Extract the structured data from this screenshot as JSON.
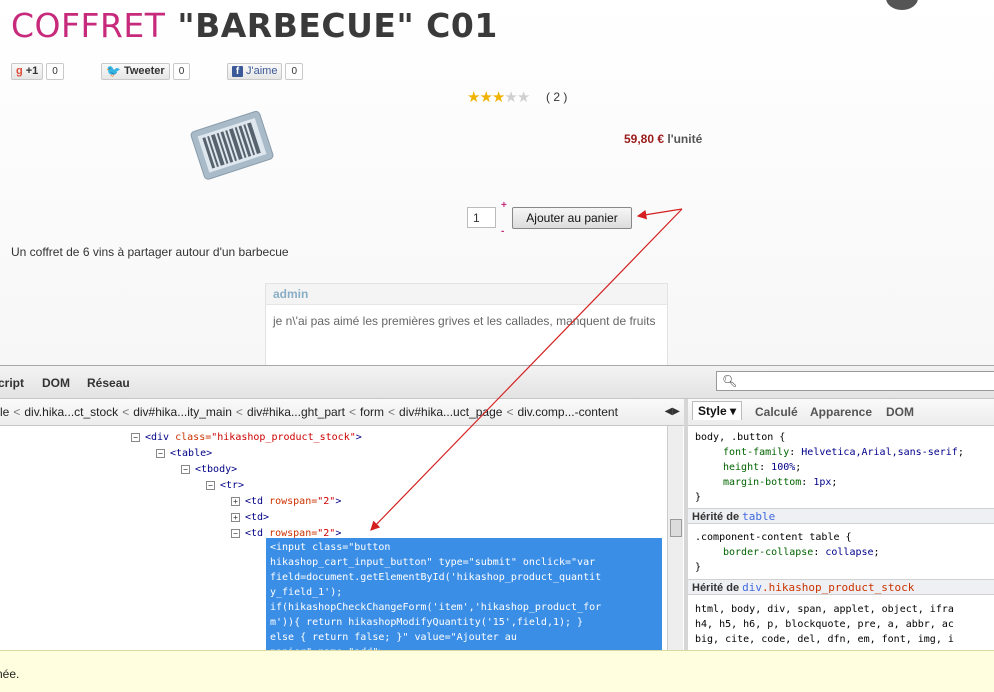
{
  "product": {
    "title_part1": "COFFRET",
    "title_part2": "\"BARBECUE\" C01",
    "vote_count": "( 2 )",
    "rating": {
      "value": 3,
      "max": 5
    },
    "price": "59,80 €",
    "price_unit": "l'unité",
    "quantity": "1",
    "plus": "+",
    "minus": "-",
    "add_to_cart": "Ajouter au panier",
    "description": "Un coffret de 6 vins à partager autour d'un barbecue"
  },
  "social": {
    "google_label": "+1",
    "google_count": "0",
    "twitter_label": "Tweeter",
    "twitter_count": "0",
    "facebook_label": "J'aime",
    "facebook_count": "0"
  },
  "comment": {
    "author": "admin",
    "text": "je n\\'ai pas aimé les premières grives et les callades, manquent de fruits"
  },
  "devtools": {
    "tabs": [
      "cript",
      "DOM",
      "Réseau"
    ],
    "breadcrumbs": [
      "le",
      "div.hika...ct_stock",
      "div#hika...ity_main",
      "div#hika...ght_part",
      "form",
      "div#hika...uct_page",
      "div.comp...-content"
    ],
    "crumb_more": "◀▶",
    "html_nodes": [
      {
        "open": "<div",
        "attr": " class=",
        "val": "\"hikashop_product_stock\"",
        "close": ">",
        "toggle": "−"
      },
      {
        "open": "<table>",
        "toggle": "−"
      },
      {
        "open": "<tbody>",
        "toggle": "−"
      },
      {
        "open": "<tr>",
        "toggle": "−"
      },
      {
        "open": "<td",
        "attr": " rowspan=",
        "val": "\"2\"",
        "close": ">",
        "toggle": "+"
      },
      {
        "open": "<td>",
        "toggle": "+"
      },
      {
        "open": "<td",
        "attr": " rowspan=",
        "val": "\"2\"",
        "close": ">",
        "toggle": "−"
      }
    ],
    "selected_source": "<input class=\"button\nhikashop_cart_input_button\" type=\"submit\" onclick=\"var\nfield=document.getElementById('hikashop_product_quantit\ny_field_1');\nif(hikashopCheckChangeForm('item','hikashop_product_for\nm')){ return hikashopModifyQuantity('15',field,1); }\nelse { return false; }\" value=\"Ajouter au\npanier\" name=\"add\">",
    "side_tabs": [
      "Style ▾",
      "Calculé",
      "Apparence",
      "DOM"
    ],
    "style_rules": {
      "rule1_selector": "body, .button {",
      "rule1_props": [
        {
          "p": "font-family",
          "v": "Helvetica,Arial,sans-serif"
        },
        {
          "p": "height",
          "v": "100%"
        },
        {
          "p": "margin-bottom",
          "v": "1px"
        }
      ],
      "close": "}",
      "inherit1_prefix": "Hérité de ",
      "inherit1_link": "table",
      "rule2_selector": ".component-content table {",
      "rule2_props": [
        {
          "p": "border-collapse",
          "v": "collapse"
        }
      ],
      "inherit2_prefix": "Hérité de ",
      "inherit2_link": "div",
      "inherit2_class": ".hikashop_product_stock",
      "rule3_lines": [
        "html, body, div, span, applet, object, ifra",
        "h4, h5, h6, p, blockquote, pre, a, abbr, ac",
        "big, cite, code, del, dfn, em, font, img, i"
      ]
    },
    "status_text": "née."
  }
}
